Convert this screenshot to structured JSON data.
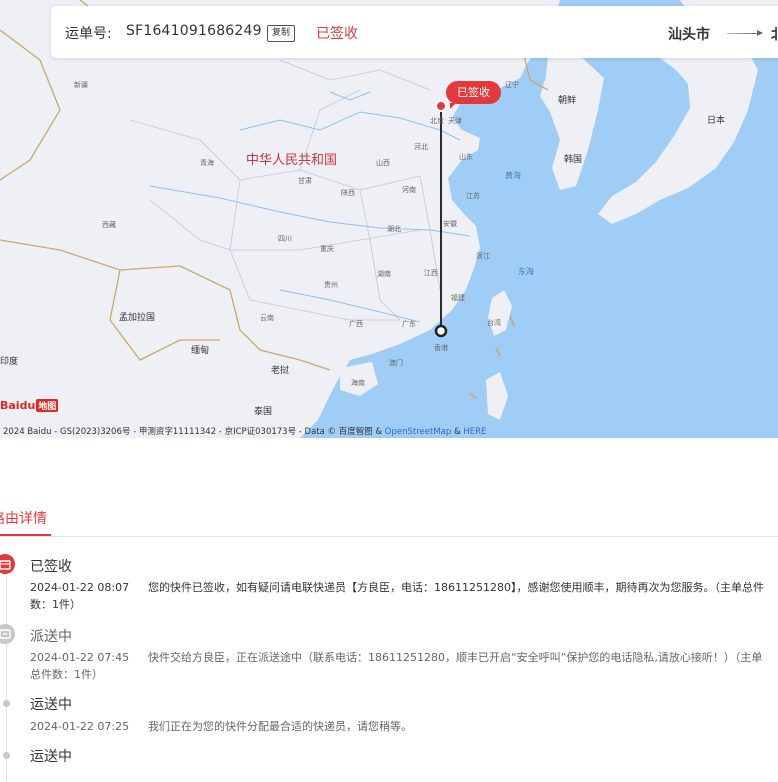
{
  "header": {
    "waybill_label": "运单号:",
    "waybill_number": "SF1641091686249",
    "copy_label": "复制",
    "status": "已签收",
    "origin_city": "汕头市",
    "dest_fragment": "北"
  },
  "map": {
    "signed_bubble": "已签收",
    "labels": {
      "china": "中华人民共和国",
      "xinjiang": "新疆",
      "qinghai": "青海",
      "xizang": "西藏",
      "gansu": "甘肃",
      "shaanxi": "陕西",
      "sichuan": "四川",
      "chongqing": "重庆",
      "guizhou": "贵州",
      "yunnan": "云南",
      "guangxi": "广西",
      "guangdong": "广东",
      "hunan": "湖南",
      "hubei": "湖北",
      "henan": "河南",
      "shanxi": "山西",
      "hebei": "河北",
      "shandong": "山东",
      "jiangsu": "江苏",
      "anhui": "安徽",
      "zhejiang": "浙江",
      "jiangxi": "江西",
      "fujian": "福建",
      "liaoning": "辽宁",
      "hainan": "海南",
      "hongkong": "香港",
      "macau": "澳门",
      "taiwan": "台湾",
      "korea_north": "朝鲜",
      "korea_south": "韩国",
      "japan": "日本",
      "bangladesh": "孟加拉国",
      "myanmar": "缅甸",
      "laos": "老挝",
      "thailand": "泰国",
      "india": "印度",
      "yellow_sea": "黄海",
      "east_sea": "东海",
      "beijing_marker": "北京",
      "tianjin": "天津"
    },
    "baidu_logo": "Baidu",
    "baidu_map_text": "地图",
    "copyright_main": "2024 Baidu - GS(2023)3206号 - 甲测资字11111342 - 京ICP证030173号 - Data © 百度智图 & ",
    "copyright_osm": "OpenStreetMap",
    "copyright_amp": " & ",
    "copyright_here": "HERE"
  },
  "tabs": {
    "active_label": "路由详情"
  },
  "timeline": {
    "n1": {
      "title": "已签收",
      "time": "2024-01-22 08:07",
      "desc": "您的快件已签收，如有疑问请电联快递员【方良臣，电话：18611251280】，感谢您使用顺丰，期待再次为您服务。（主单总件数：1件）"
    },
    "n2": {
      "title": "派送中",
      "time": "2024-01-22 07:45",
      "desc": "快件交给方良臣，正在派送途中（联系电话：18611251280，顺丰已开启“安全呼叫”保护您的电话隐私,请放心接听！）（主单总件数：1件）"
    },
    "n3": {
      "title": "运送中",
      "time": "2024-01-22 07:25",
      "desc": "我们正在为您的快件分配最合适的快递员，请您稍等。"
    },
    "n4": {
      "title": "运送中"
    }
  },
  "colors": {
    "accent": "#e4393c",
    "sea": "#9fcdf5",
    "land": "#eef0f5",
    "route": "#2b2b2b"
  },
  "icons": {
    "signed": "signed-box-icon",
    "delivering": "courier-icon",
    "transit": "dot-icon"
  }
}
